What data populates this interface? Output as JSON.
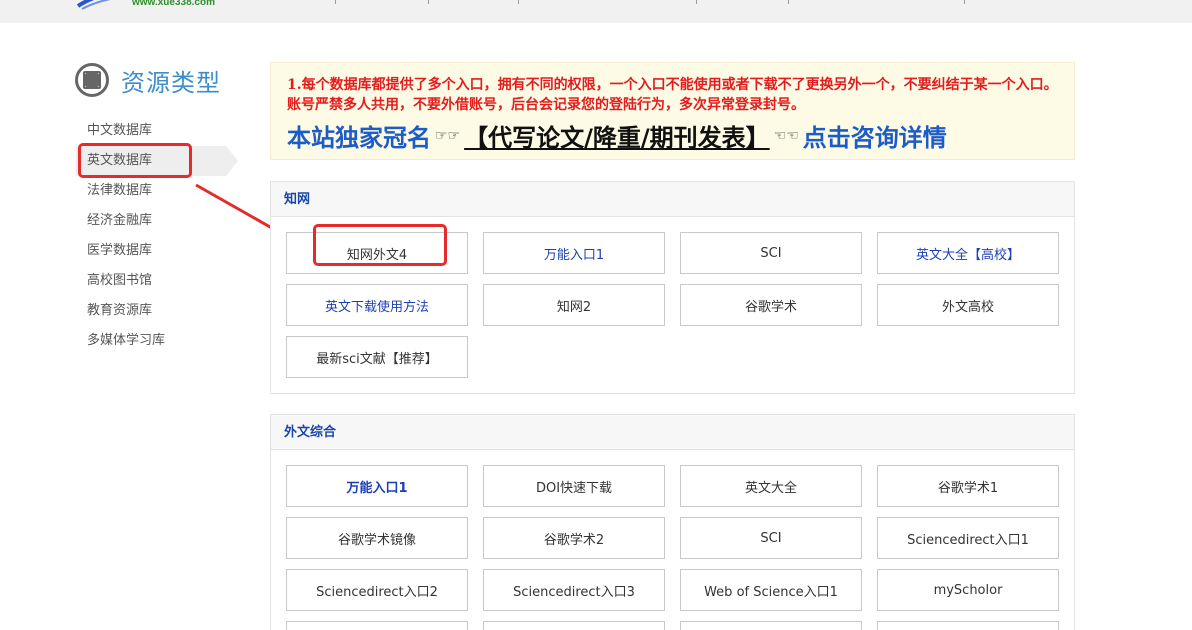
{
  "header": {
    "site_url": "www.xue338.com"
  },
  "sidebar": {
    "title": "资源类型",
    "items": [
      {
        "label": "中文数据库"
      },
      {
        "label": "英文数据库"
      },
      {
        "label": "法律数据库"
      },
      {
        "label": "经济金融库"
      },
      {
        "label": "医学数据库"
      },
      {
        "label": "高校图书馆"
      },
      {
        "label": "教育资源库"
      },
      {
        "label": "多媒体学习库"
      }
    ]
  },
  "notice": {
    "text": "1.每个数据库都提供了多个入口，拥有不同的权限，一个入口不能使用或者下载不了更换另外一个，不要纠结于某一个入口。账号严禁多人共用，不要外借账号，后台会记录您的登陆行为，多次异常登录封号。",
    "promo_left": "本站独家冠名",
    "promo_mid": "【代写论文/降重/期刊发表】",
    "promo_right": "点击咨询详情",
    "hand_right": "☞☞",
    "hand_left": "☜☜"
  },
  "panels": [
    {
      "title": "知网",
      "buttons": [
        "知网外文4",
        "万能入口1",
        "SCI",
        "英文大全【高校】",
        "英文下载使用方法",
        "知网2",
        "谷歌学术",
        "外文高校",
        "最新sci文献【推荐】"
      ]
    },
    {
      "title": "外文综合",
      "buttons": [
        "万能入口1",
        "DOI快速下载",
        "英文大全",
        "谷歌学术1",
        "谷歌学术镜像",
        "谷歌学术2",
        "SCI",
        "Sciencedirect入口1",
        "Sciencedirect入口2",
        "Sciencedirect入口3",
        "Web of Science入口1",
        "myScholor"
      ]
    }
  ],
  "colors": {
    "accent_blue": "#3c8dca",
    "link_blue": "#1d3fb5",
    "alert_red": "#e21d1d",
    "annotation_red": "#e52b2b"
  }
}
